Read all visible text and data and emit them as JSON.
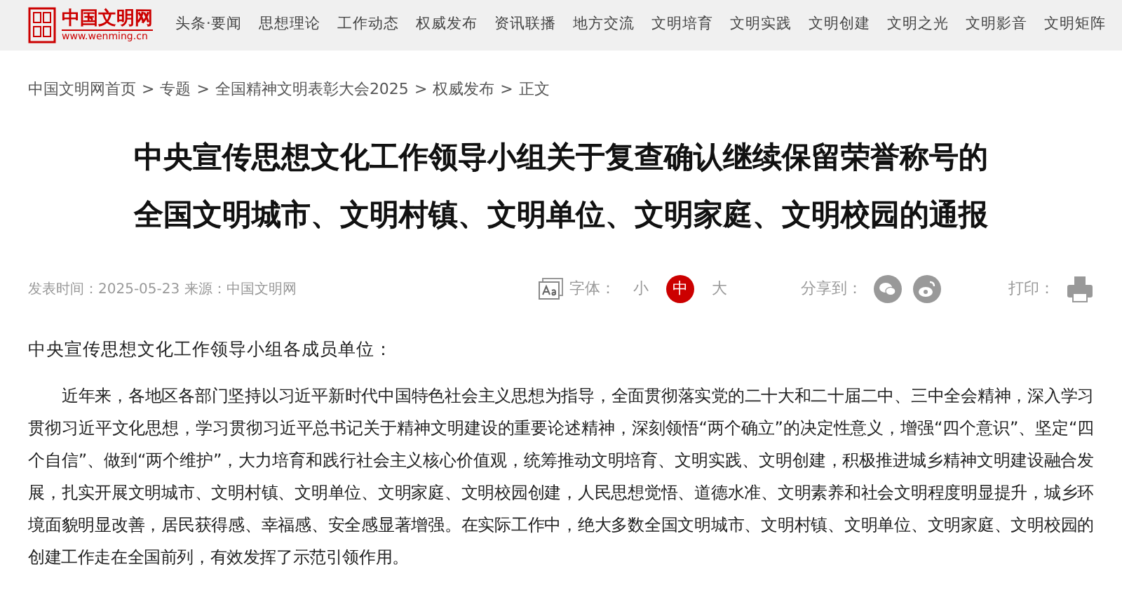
{
  "header": {
    "site_name": "中国文明网",
    "site_url": "www.wenming.cn",
    "nav": [
      "头条·要闻",
      "思想理论",
      "工作动态",
      "权威发布",
      "资讯联播",
      "地方交流",
      "文明培育",
      "文明实践",
      "文明创建",
      "文明之光",
      "文明影音",
      "文明矩阵"
    ]
  },
  "breadcrumb": [
    "中国文明网首页",
    "专题",
    "全国精神文明表彰大会2025",
    "权威发布",
    "正文"
  ],
  "breadcrumb_separator": ">",
  "article": {
    "title_lines": [
      "中央宣传思想文化工作领导小组关于复查确认继续保留荣誉称号的",
      "全国文明城市、文明村镇、文明单位、文明家庭、文明校园的通报"
    ],
    "meta": "发表时间：2025-05-23 来源：中国文明网",
    "font_label": "字体：",
    "font_sizes": [
      {
        "label": "小",
        "selected": false
      },
      {
        "label": "中",
        "selected": true
      },
      {
        "label": "大",
        "selected": false
      }
    ],
    "share_label": "分享到：",
    "print_label": "打印：",
    "salutation": "中央宣传思想文化工作领导小组各成员单位：",
    "paragraphs": [
      "近年来，各地区各部门坚持以习近平新时代中国特色社会主义思想为指导，全面贯彻落实党的二十大和二十届二中、三中全会精神，深入学习贯彻习近平文化思想，学习贯彻习近平总书记关于精神文明建设的重要论述精神，深刻领悟“两个确立”的决定性意义，增强“四个意识”、坚定“四个自信”、做到“两个维护”，大力培育和践行社会主义核心价值观，统筹推动文明培育、文明实践、文明创建，积极推进城乡精神文明建设融合发展，扎实开展文明城市、文明村镇、文明单位、文明家庭、文明校园创建，人民思想觉悟、道德水准、文明素养和社会文明程度明显提升，城乡环境面貌明显改善，居民获得感、幸福感、安全感显著增强。在实际工作中，绝大多数全国文明城市、文明村镇、文明单位、文明家庭、文明校园的创建工作走在全国前列，有效发挥了示范引领作用。"
    ]
  }
}
